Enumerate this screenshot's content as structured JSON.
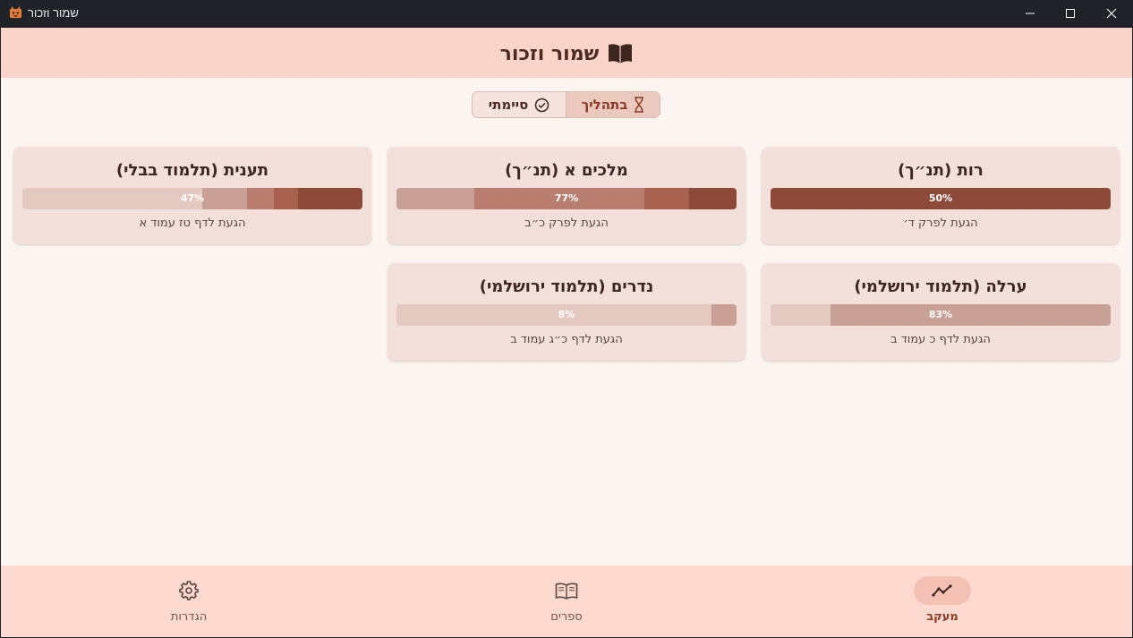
{
  "window": {
    "title": "שמור וזכור",
    "icons": [
      "app-icon",
      "minimize-icon",
      "maximize-icon",
      "close-icon"
    ]
  },
  "header": {
    "title": "שמור וזכור",
    "icon": "open-book-icon"
  },
  "filter": {
    "in_progress": {
      "label": "בתהליך",
      "icon": "hourglass-icon",
      "selected": true
    },
    "finished": {
      "label": "סיימתי",
      "icon": "check-circle-icon",
      "selected": false
    }
  },
  "colors": {
    "accent": "#8a3a22",
    "header_bg": "#fbd4c9",
    "card_bg": "#f3e0da",
    "bar_track": "#e3c9bf"
  },
  "cards": [
    {
      "title": "רות (תנ״ך)",
      "progress_label": "50%",
      "status": "הגעת לפרק ד׳",
      "segments": [
        {
          "from": 0.0,
          "to": 1.0,
          "color": "#8e4a38"
        }
      ]
    },
    {
      "title": "מלכים א (תנ״ך)",
      "progress_label": "77%",
      "status": "הגעת לפרק כ״ב",
      "segments": [
        {
          "from": 0.0,
          "to": 0.14,
          "color": "#8e4a38"
        },
        {
          "from": 0.14,
          "to": 0.27,
          "color": "#a9614f"
        },
        {
          "from": 0.27,
          "to": 0.77,
          "color": "#b97e70"
        },
        {
          "from": 0.77,
          "to": 1.0,
          "color": "#c9a095"
        }
      ]
    },
    {
      "title": "תענית (תלמוד בבלי)",
      "progress_label": "47%",
      "status": "הגעת לדף טז עמוד א",
      "segments": [
        {
          "from": 0.0,
          "to": 0.19,
          "color": "#8e4a38"
        },
        {
          "from": 0.19,
          "to": 0.26,
          "color": "#a9614f"
        },
        {
          "from": 0.26,
          "to": 0.34,
          "color": "#b97e70"
        },
        {
          "from": 0.34,
          "to": 0.47,
          "color": "#c9a095"
        }
      ]
    },
    {
      "title": "ערלה (תלמוד ירושלמי)",
      "progress_label": "83%",
      "status": "הגעת לדף כ עמוד ב",
      "segments": [
        {
          "from": 0.0,
          "to": 0.825,
          "color": "#c9a095"
        }
      ]
    },
    {
      "title": "נדרים (תלמוד ירושלמי)",
      "progress_label": "8%",
      "status": "הגעת לדף כ״ג עמוד ב",
      "segments": [
        {
          "from": 0.0,
          "to": 0.075,
          "color": "#c9a095"
        }
      ]
    }
  ],
  "nav": [
    {
      "label": "מעקב",
      "icon": "trending-icon",
      "active": true
    },
    {
      "label": "ספרים",
      "icon": "book-icon",
      "active": false
    },
    {
      "label": "הגדרות",
      "icon": "gear-icon",
      "active": false
    }
  ]
}
